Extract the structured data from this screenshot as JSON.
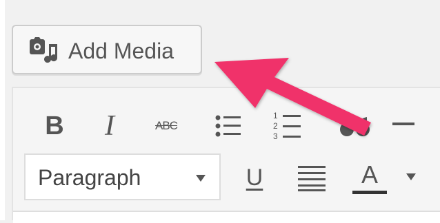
{
  "add_media": {
    "label": "Add Media",
    "icon": "add-media-icon"
  },
  "toolbar_row1": [
    {
      "name": "bold",
      "label": "B"
    },
    {
      "name": "italic",
      "label": "I"
    },
    {
      "name": "strikethrough",
      "label": "ABC"
    },
    {
      "name": "bullet-list",
      "icon": "bullet-list-icon"
    },
    {
      "name": "numbered-list",
      "icon": "numbered-list-icon"
    },
    {
      "name": "blockquote",
      "icon": "blockquote-icon"
    },
    {
      "name": "horizontal-rule",
      "icon": "horizontal-rule-icon"
    }
  ],
  "toolbar_row2": {
    "format_select": "Paragraph",
    "underline": "U",
    "justify_icon": "justify-icon",
    "text_color": "A"
  },
  "annotation": {
    "icon": "pointer-arrow",
    "color": "#f0306b"
  },
  "colors": {
    "icon": "#555555",
    "background": "#f1f1f1"
  }
}
